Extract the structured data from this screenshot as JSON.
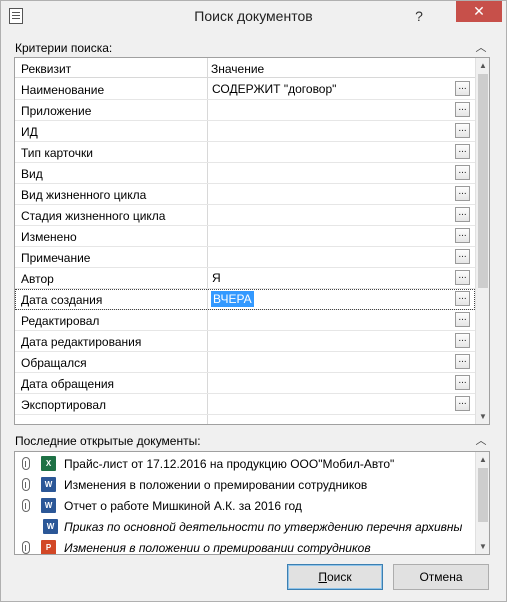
{
  "window": {
    "title": "Поиск документов",
    "help_glyph": "?",
    "close_glyph": "✕"
  },
  "criteria": {
    "label": "Критерии поиска:",
    "columns": [
      "Реквизит",
      "Значение"
    ],
    "rows": [
      {
        "prop": "Наименование",
        "value": "СОДЕРЖИТ \"договор\""
      },
      {
        "prop": "Приложение",
        "value": ""
      },
      {
        "prop": "ИД",
        "value": ""
      },
      {
        "prop": "Тип карточки",
        "value": ""
      },
      {
        "prop": "Вид",
        "value": ""
      },
      {
        "prop": "Вид жизненного цикла",
        "value": ""
      },
      {
        "prop": "Стадия жизненного цикла",
        "value": ""
      },
      {
        "prop": "Изменено",
        "value": ""
      },
      {
        "prop": "Примечание",
        "value": ""
      },
      {
        "prop": "Автор",
        "value": "Я"
      },
      {
        "prop": "Дата создания",
        "value": "ВЧЕРА"
      },
      {
        "prop": "Редактировал",
        "value": ""
      },
      {
        "prop": "Дата редактирования",
        "value": ""
      },
      {
        "prop": "Обращался",
        "value": ""
      },
      {
        "prop": "Дата обращения",
        "value": ""
      },
      {
        "prop": "Экспортировал",
        "value": ""
      }
    ],
    "ellipsis": "..."
  },
  "recent": {
    "label": "Последние открытые документы:",
    "items": [
      {
        "text": "Прайс-лист от 17.12.2016 на продукцию ООО\"Мобил-Авто\"",
        "icon": "excel-icon",
        "clip": true,
        "italic": false
      },
      {
        "text": "Изменения в положении о премировании сотрудников",
        "icon": "word-icon",
        "clip": true,
        "italic": false
      },
      {
        "text": "Отчет о работе Мишкиной А.К. за 2016 год",
        "icon": "word-icon",
        "clip": true,
        "italic": false
      },
      {
        "text": "Приказ по основной деятельности по утверждению перечня архивны",
        "icon": "word-icon",
        "clip": false,
        "italic": true
      },
      {
        "text": "Изменения в положении о премировании сотрудников",
        "icon": "powerpoint-icon",
        "clip": true,
        "italic": true
      }
    ]
  },
  "buttons": {
    "search": "Поиск",
    "search_u": "П",
    "search_rest": "оиск",
    "cancel": "Отмена"
  }
}
